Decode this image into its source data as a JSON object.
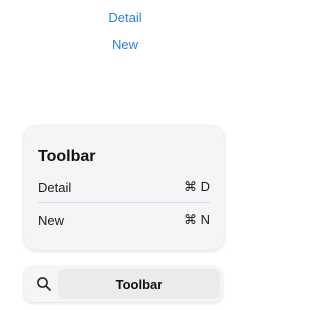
{
  "top_links": {
    "detail": "Detail",
    "new": "New"
  },
  "menu": {
    "title": "Toolbar",
    "items": [
      {
        "label": "Detail",
        "shortcut": "⌘ D"
      },
      {
        "label": "New",
        "shortcut": "⌘ N"
      }
    ]
  },
  "toolbar": {
    "search_icon": "magnifying-glass",
    "label": "Toolbar"
  },
  "colors": {
    "link": "#2f7fe0",
    "panel": "#f5f5f7"
  }
}
